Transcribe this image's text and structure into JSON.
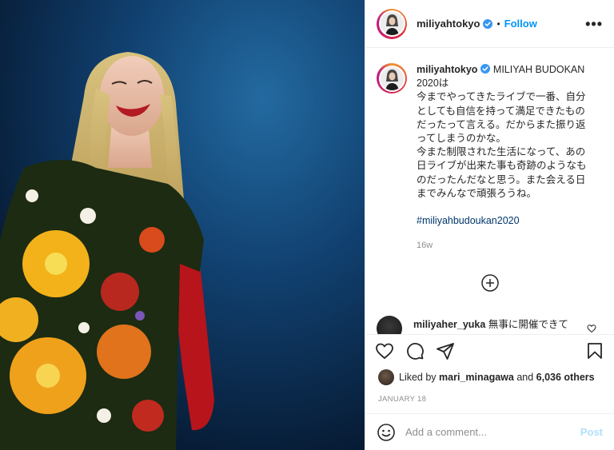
{
  "post": {
    "username": "miliyahtokyo",
    "follow_label": "Follow",
    "dot": "•",
    "more_label": "•••"
  },
  "caption": {
    "username": "miliyahtokyo",
    "lines": [
      "MILIYAH BUDOKAN",
      "2020は",
      "今までやってきたライブで一番、自分",
      "としても自信を持って満足できたもの",
      "だったって言える。だからまた振り返",
      "ってしまうのかな。",
      "今また制限された生活になって、あの",
      "日ライブが出来た事も奇跡のようなも",
      "のだったんだなと思う。また会える日",
      "までみんなで頑張ろうね。"
    ],
    "hashtag": "#miliyahbudoukan2020",
    "time": "16w"
  },
  "comment": {
    "username": "miliyaher_yuka",
    "text": "無事に開催できて"
  },
  "likes": {
    "prefix": "Liked by",
    "user": "mari_minagawa",
    "conj": "and",
    "count": "6,036 others"
  },
  "date": "JANUARY 18",
  "add_comment": {
    "placeholder": "Add a comment...",
    "post_label": "Post"
  },
  "colors": {
    "accent": "#0095f6",
    "post_disabled": "#b2dffc",
    "hashtag": "#00376b",
    "muted": "#8e8e8e"
  },
  "icons": [
    "verified-badge-icon",
    "more-options-icon",
    "load-more-comments-icon",
    "heart-icon",
    "comment-icon",
    "share-icon",
    "bookmark-icon",
    "emoji-icon"
  ]
}
